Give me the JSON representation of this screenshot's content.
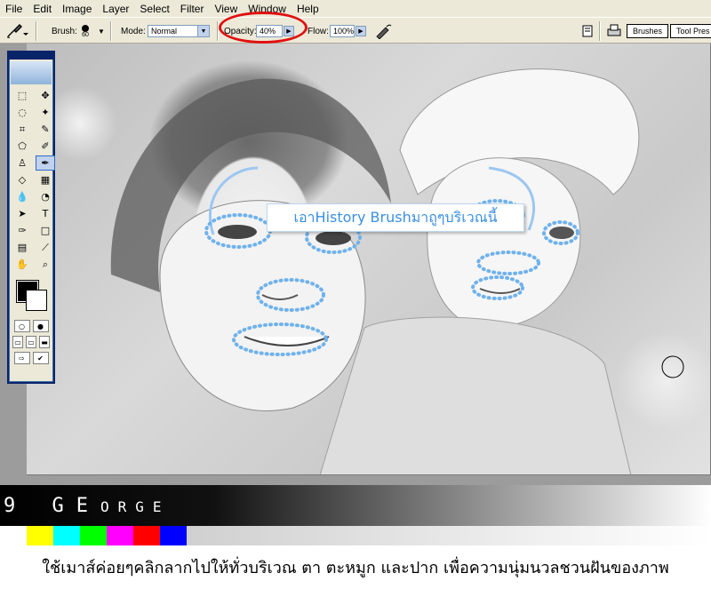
{
  "menu": [
    "File",
    "Edit",
    "Image",
    "Layer",
    "Select",
    "Filter",
    "View",
    "Window",
    "Help"
  ],
  "options": {
    "brush_label": "Brush:",
    "brush_size": "60",
    "mode_label": "Mode:",
    "mode_value": "Normal",
    "opacity_label": "Opacity:",
    "opacity_value": "40%",
    "flow_label": "Flow:",
    "flow_value": "100%",
    "tabs": [
      "Brushes",
      "Tool Pres"
    ]
  },
  "callout": "เอาHistory Brushมาถูๆบริเวณนี้",
  "brand": {
    "large": "9 GE",
    "small": "ORGE"
  },
  "colorbar": [
    "#ffffff",
    "#ffff00",
    "#00ffff",
    "#00ff00",
    "#ff00ff",
    "#ff0000",
    "#0000ff"
  ],
  "caption": "ใช้เมาส์ค่อยๆคลิกลากไปให้ทั่วบริเวณ ตา ตะหมูก และปาก เพื่อความนุ่มนวลชวนฝันของภาพ",
  "icons": {
    "history_brush": "history-brush-icon",
    "airbrush": "airbrush-icon",
    "brush_dot": "brush-dot-icon"
  }
}
